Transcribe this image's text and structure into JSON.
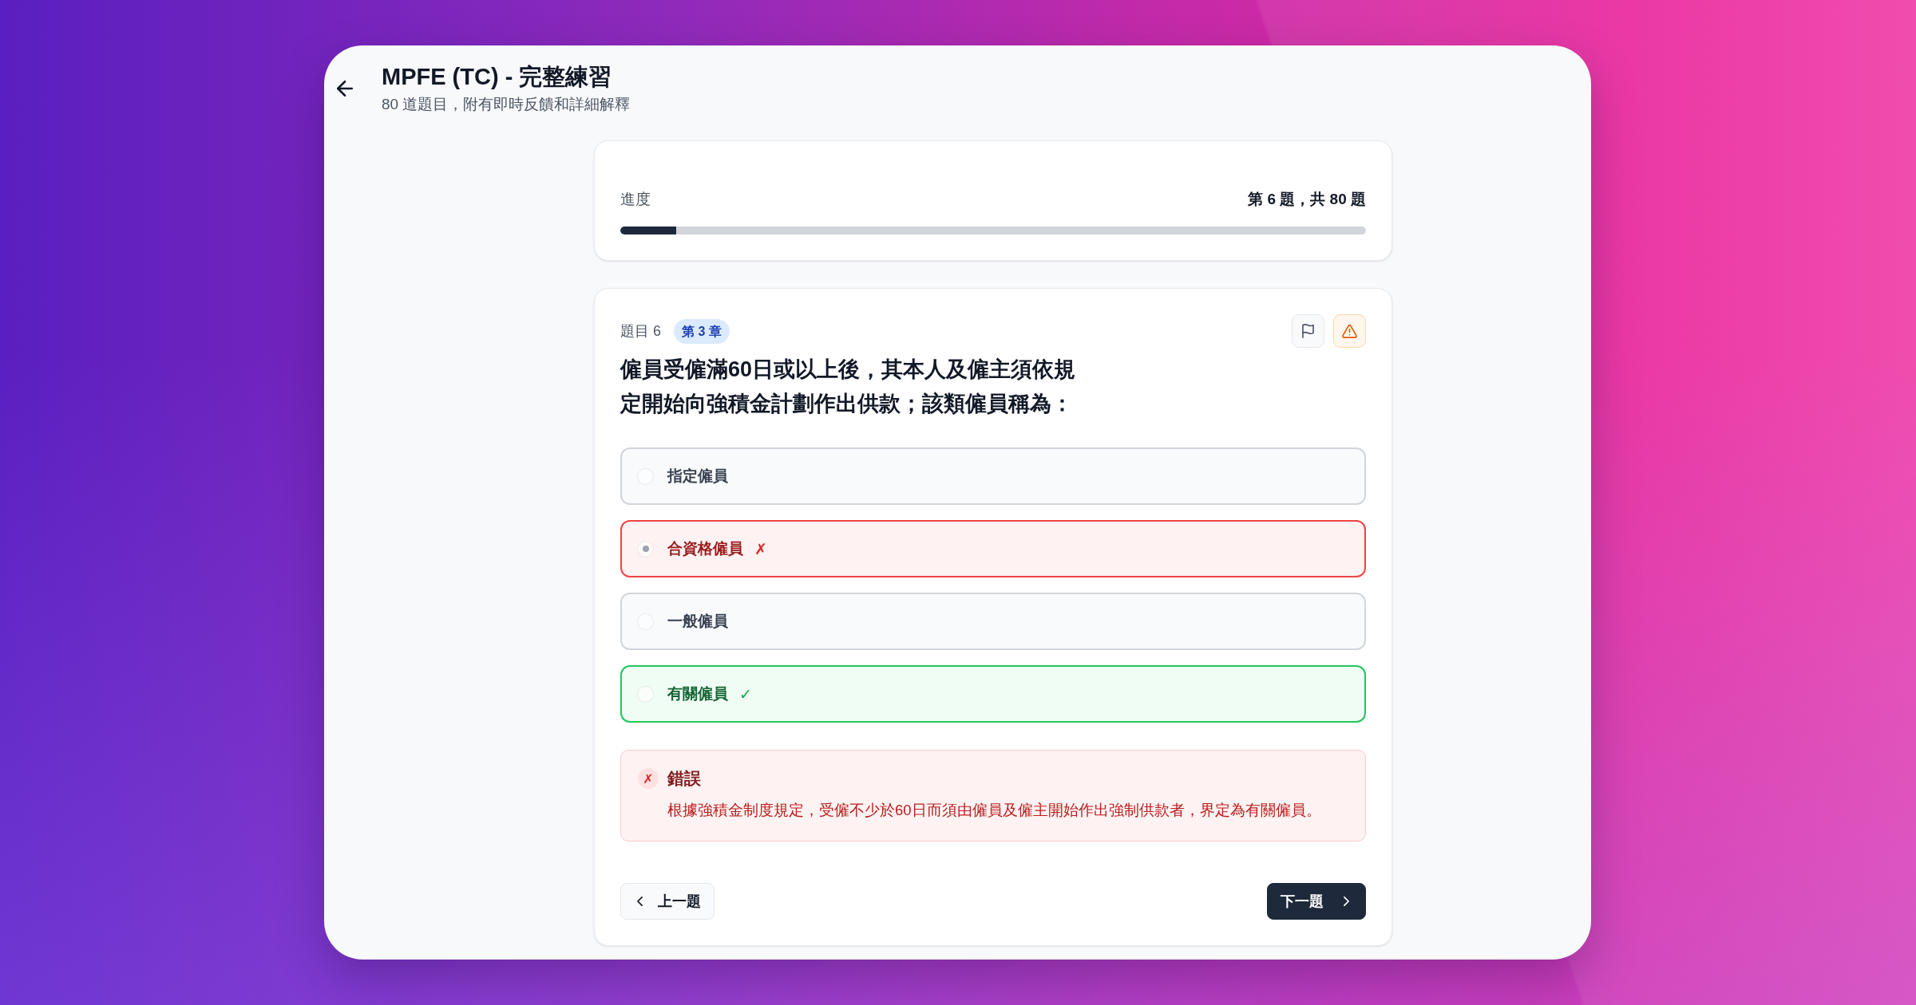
{
  "header": {
    "title": "MPFE (TC) - 完整練習",
    "subtitle": "80 道題目，附有即時反饋和詳細解釋"
  },
  "progress": {
    "label": "進度",
    "count": "第 6 題，共 80 題",
    "level": 0.075
  },
  "question": {
    "number": "題目 6",
    "chapter": "第 3 章",
    "text": "僱員受僱滿60日或以上後，其本人及僱主須依規定開始向強積金計劃作出供款；該類僱員稱為："
  },
  "options": [
    {
      "label": "指定僱員",
      "selected": false,
      "kind": "neutral"
    },
    {
      "label": "合資格僱員",
      "selected": true,
      "kind": "wrong",
      "mark": "✗"
    },
    {
      "label": "一般僱員",
      "selected": false,
      "kind": "neutral"
    },
    {
      "label": "有關僱員",
      "selected": false,
      "kind": "correct",
      "mark": "✓"
    }
  ],
  "feedback": {
    "kind": "wrong",
    "icon": "✗",
    "title": "錯誤",
    "text": "根據強積金制度規定，受僱不少於60日而須由僱員及僱主開始作出強制供款者，界定為有關僱員。"
  },
  "navigation": [
    {
      "kind": "previous",
      "label": "上一題"
    },
    {
      "kind": "next",
      "label": "下一題"
    }
  ]
}
